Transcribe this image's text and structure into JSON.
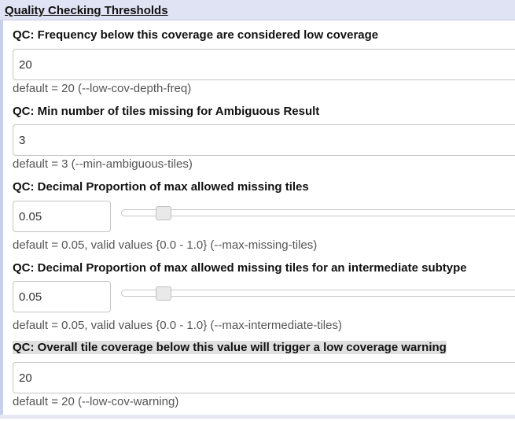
{
  "section": {
    "title": "Quality Checking Thresholds"
  },
  "fields": [
    {
      "label": "QC: Frequency below this coverage are considered low coverage",
      "value": "20",
      "help": "default = 20 (--low-cov-depth-freq)"
    },
    {
      "label": "QC: Min number of tiles missing for Ambiguous Result",
      "value": "3",
      "help": "default = 3 (--min-ambiguous-tiles)"
    },
    {
      "label": "QC: Decimal Proportion of max allowed missing tiles",
      "value": "0.05",
      "help": "default = 0.05, valid values {0.0 - 1.0} (--max-missing-tiles)",
      "slider": {
        "min": 0.0,
        "max": 1.0,
        "value": 0.05
      }
    },
    {
      "label": "QC: Decimal Proportion of max allowed missing tiles for an intermediate subtype",
      "value": "0.05",
      "help": "default = 0.05, valid values {0.0 - 1.0} (--max-intermediate-tiles)",
      "slider": {
        "min": 0.0,
        "max": 1.0,
        "value": 0.05
      }
    },
    {
      "label": "QC: Overall tile coverage below this value will trigger a low coverage warning",
      "value": "20",
      "help": "default = 20 (--low-cov-warning)"
    }
  ]
}
